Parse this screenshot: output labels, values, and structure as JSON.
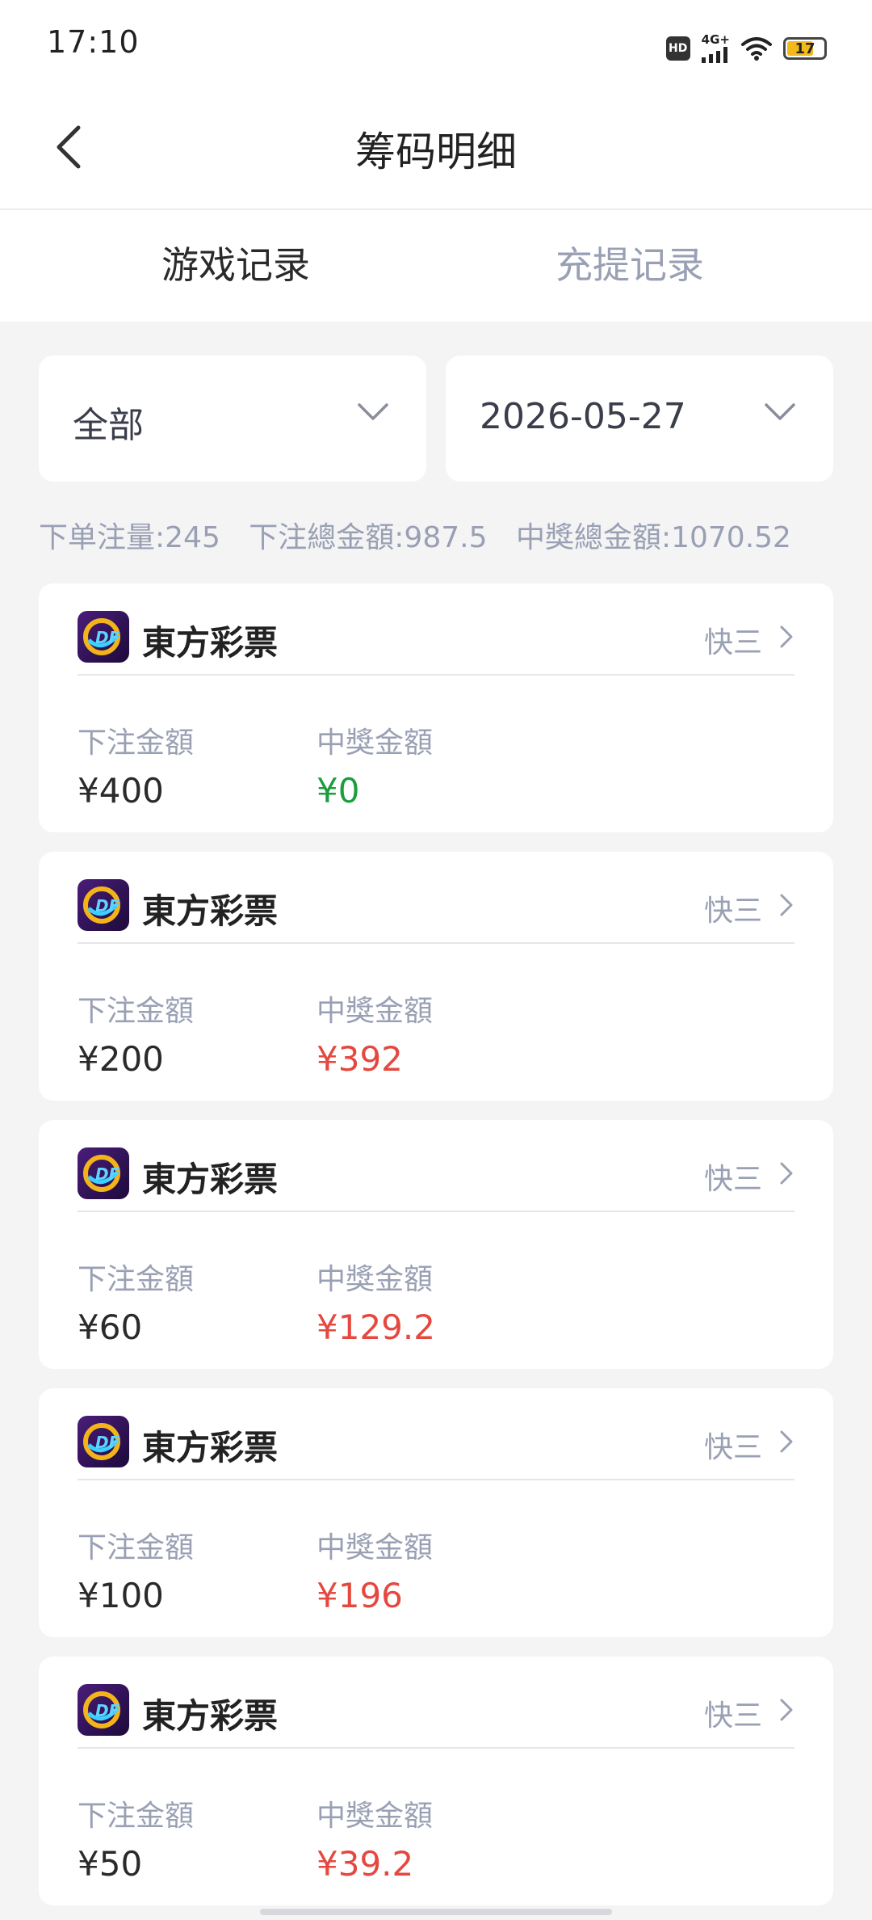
{
  "status": {
    "time": "17:10",
    "hd": "HD",
    "network": "4G+",
    "battery": "17"
  },
  "nav": {
    "title": "筹码明细"
  },
  "tabs": [
    {
      "label": "游戏记录",
      "active": true
    },
    {
      "label": "充提记录",
      "active": false
    }
  ],
  "filters": {
    "category": "全部",
    "date": "2026-05-27"
  },
  "summary": {
    "order_count": "下单注量:245",
    "bet_total": "下注總金額:987.5",
    "win_total": "中獎總金額:1070.52"
  },
  "labels": {
    "bet": "下注金額",
    "win": "中獎金額"
  },
  "colors": {
    "win_positive": "#e5483f",
    "win_zero": "#1a9e3c",
    "muted": "#9aa0b4"
  },
  "records": [
    {
      "name": "東方彩票",
      "type": "快三",
      "bet": "¥400",
      "win": "¥0",
      "win_color": "#1a9e3c"
    },
    {
      "name": "東方彩票",
      "type": "快三",
      "bet": "¥200",
      "win": "¥392",
      "win_color": "#e5483f"
    },
    {
      "name": "東方彩票",
      "type": "快三",
      "bet": "¥60",
      "win": "¥129.2",
      "win_color": "#e5483f"
    },
    {
      "name": "東方彩票",
      "type": "快三",
      "bet": "¥100",
      "win": "¥196",
      "win_color": "#e5483f"
    },
    {
      "name": "東方彩票",
      "type": "快三",
      "bet": "¥50",
      "win": "¥39.2",
      "win_color": "#e5483f"
    }
  ]
}
